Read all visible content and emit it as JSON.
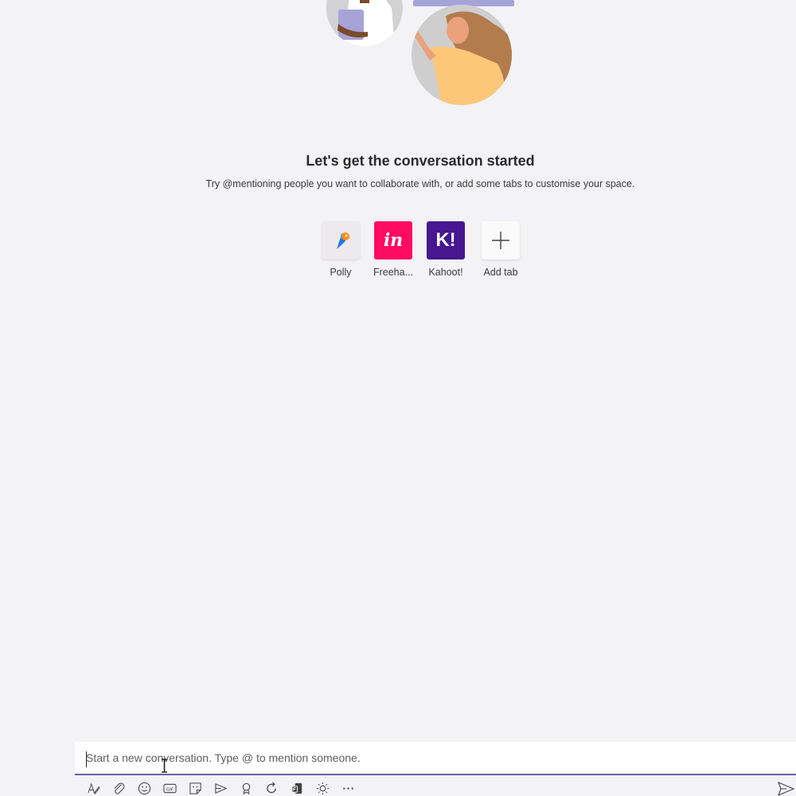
{
  "empty_state": {
    "title": "Let's get the conversation started",
    "subtitle": "Try @mentioning people you want to collaborate with, or add some tabs to customise your space."
  },
  "apps": [
    {
      "label": "Polly",
      "icon": "polly-app-icon"
    },
    {
      "label": "Freeha...",
      "icon": "freehand-app-icon",
      "glyph": "in"
    },
    {
      "label": "Kahoot!",
      "icon": "kahoot-app-icon",
      "glyph": "K!"
    },
    {
      "label": "Add tab",
      "icon": "plus-icon"
    }
  ],
  "compose": {
    "placeholder": "Start a new conversation. Type @ to mention someone.",
    "value": ""
  },
  "toolbar": {
    "icons": [
      "format-icon",
      "attach-icon",
      "emoji-icon",
      "gif-icon",
      "sticker-icon",
      "meet-now-icon",
      "praise-icon",
      "loop-icon",
      "forms-icon",
      "brightness-icon",
      "more-options-icon"
    ],
    "send_icon": "send-icon"
  },
  "colors": {
    "background": "#f3f2f5",
    "accent": "#6264a7",
    "freehand": "#ff0b61",
    "kahoot": "#46178f"
  }
}
